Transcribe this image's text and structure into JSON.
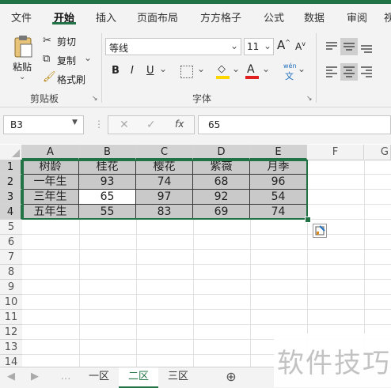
{
  "ribbon_tabs": [
    "文件",
    "开始",
    "插入",
    "页面布局",
    "方方格子",
    "公式",
    "数据",
    "审阅",
    "视"
  ],
  "clipboard": {
    "paste": "粘贴",
    "cut": "剪切",
    "copy": "复制",
    "format_painter": "格式刷",
    "group_label": "剪贴板"
  },
  "font": {
    "name": "等线",
    "size": "11",
    "grow": "A",
    "shrink": "A",
    "bold": "B",
    "italic": "I",
    "underline": "U",
    "font_color_letter": "A",
    "phonetic": "文",
    "phonetic_top": "wén",
    "group_label": "字体"
  },
  "formula_bar": {
    "name_box": "B3",
    "cancel": "✕",
    "enter": "✓",
    "fx": "fx",
    "value": "65"
  },
  "columns": [
    "A",
    "B",
    "C",
    "D",
    "E",
    "F",
    "G"
  ],
  "rows": [
    "1",
    "2",
    "3",
    "4",
    "5",
    "6",
    "7",
    "8",
    "9",
    "10",
    "11",
    "12",
    "13",
    "14"
  ],
  "table": {
    "header": [
      "树龄",
      "桂花",
      "樱花",
      "紫薇",
      "月季"
    ],
    "rows": [
      [
        "一年生",
        "93",
        "74",
        "68",
        "96"
      ],
      [
        "三年生",
        "65",
        "97",
        "92",
        "54"
      ],
      [
        "五年生",
        "55",
        "83",
        "69",
        "74"
      ]
    ]
  },
  "sheets": [
    "一区",
    "二区",
    "三区"
  ],
  "active_sheet": "二区",
  "watermark": "软件技巧",
  "colors": {
    "accent": "#217346",
    "selection_fill": "#c9c9c9"
  }
}
